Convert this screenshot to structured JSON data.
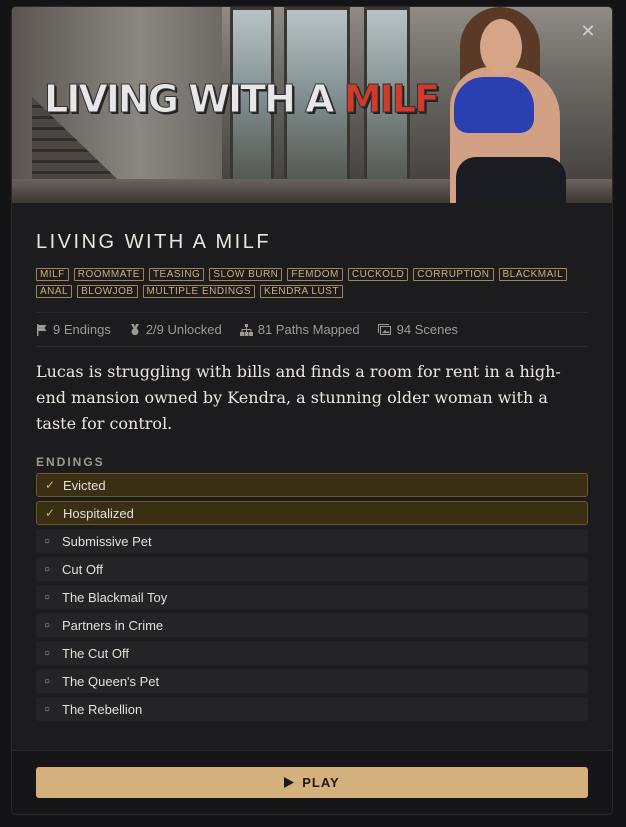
{
  "game": {
    "logo_main": "LIVING WITH A",
    "logo_accent": "MILF",
    "title": "LIVING WITH A MILF",
    "close_icon": "close-icon"
  },
  "tags": [
    "MILF",
    "ROOMMATE",
    "TEASING",
    "SLOW BURN",
    "FEMDOM",
    "CUCKOLD",
    "CORRUPTION",
    "BLACKMAIL",
    "ANAL",
    "BLOWJOB",
    "MULTIPLE ENDINGS",
    "KENDRA LUST"
  ],
  "stats": {
    "endings": "9 Endings",
    "unlocked": "2/9 Unlocked",
    "paths": "81 Paths Mapped",
    "scenes": "94 Scenes"
  },
  "description": "Lucas is struggling with bills and finds a room for rent in a high-end mansion owned by Kendra, a stunning older woman with a taste for control.",
  "endings_header": "ENDINGS",
  "endings": [
    {
      "label": "Evicted",
      "unlocked": true
    },
    {
      "label": "Hospitalized",
      "unlocked": true
    },
    {
      "label": "Submissive Pet",
      "unlocked": false
    },
    {
      "label": "Cut Off",
      "unlocked": false
    },
    {
      "label": "The Blackmail Toy",
      "unlocked": false
    },
    {
      "label": "Partners in Crime",
      "unlocked": false
    },
    {
      "label": "The Cut Off",
      "unlocked": false
    },
    {
      "label": "The Queen's Pet",
      "unlocked": false
    },
    {
      "label": "The Rebellion",
      "unlocked": false
    }
  ],
  "play_label": "PLAY",
  "colors": {
    "accent": "#d4b07c",
    "tag_border": "#a38553",
    "unlocked_bg": "#3a2f12"
  }
}
